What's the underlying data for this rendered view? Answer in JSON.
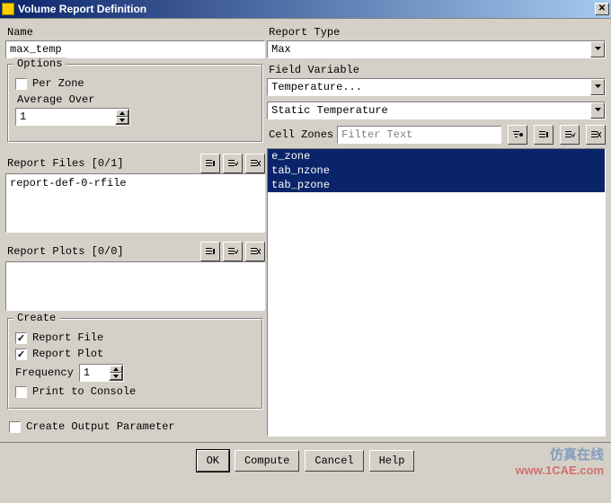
{
  "title": "Volume Report Definition",
  "name_label": "Name",
  "name_value": "max_temp",
  "options_legend": "Options",
  "per_zone_label": "Per Zone",
  "per_zone_checked": false,
  "avg_over_label": "Average Over",
  "avg_over_value": "1",
  "report_files_label": "Report Files [0/1]",
  "report_files_items": [
    "report-def-0-rfile"
  ],
  "report_plots_label": "Report Plots [0/0]",
  "create_legend": "Create",
  "report_file_label": "Report File",
  "report_file_checked": true,
  "report_plot_label": "Report Plot",
  "report_plot_checked": true,
  "frequency_label": "Frequency",
  "frequency_value": "1",
  "print_console_label": "Print to Console",
  "print_console_checked": false,
  "create_output_label": "Create Output Parameter",
  "create_output_checked": false,
  "report_type_label": "Report Type",
  "report_type_value": "Max",
  "field_variable_label": "Field Variable",
  "field_variable_value1": "Temperature...",
  "field_variable_value2": "Static Temperature",
  "cell_zones_label": "Cell Zones",
  "cell_zones_placeholder": "Filter Text",
  "cell_zones_items": [
    "e_zone",
    "tab_nzone",
    "tab_pzone"
  ],
  "buttons": {
    "ok": "OK",
    "compute": "Compute",
    "cancel": "Cancel",
    "help": "Help"
  },
  "watermark": {
    "l1": "仿真在线",
    "l2": "www.1CAE.com"
  }
}
